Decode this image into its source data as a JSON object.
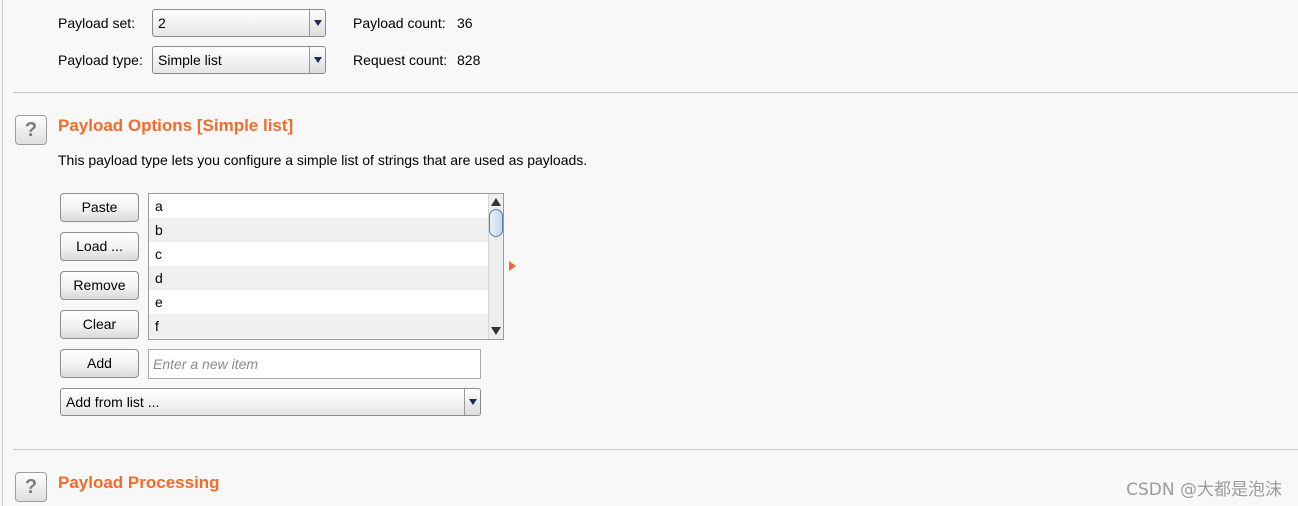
{
  "payload_set": {
    "label": "Payload set:",
    "value": "2"
  },
  "payload_type": {
    "label": "Payload type:",
    "value": "Simple list"
  },
  "payload_count": {
    "label": "Payload count:",
    "value": "36"
  },
  "request_count": {
    "label": "Request count:",
    "value": "828"
  },
  "options_section": {
    "help_icon": "?",
    "title": "Payload Options [Simple list]",
    "description": "This payload type lets you configure a simple list of strings that are used as payloads.",
    "buttons": {
      "paste": "Paste",
      "load": "Load ...",
      "remove": "Remove",
      "clear": "Clear",
      "add": "Add"
    },
    "list_items": [
      "a",
      "b",
      "c",
      "d",
      "e",
      "f"
    ],
    "new_item_placeholder": "Enter a new item",
    "add_from_list": "Add from list ..."
  },
  "processing_section": {
    "help_icon": "?",
    "title": "Payload Processing"
  },
  "watermark": "CSDN @大都是泡沫",
  "colors": {
    "accent": "#f26b2a",
    "background": "#f8f8f8"
  }
}
